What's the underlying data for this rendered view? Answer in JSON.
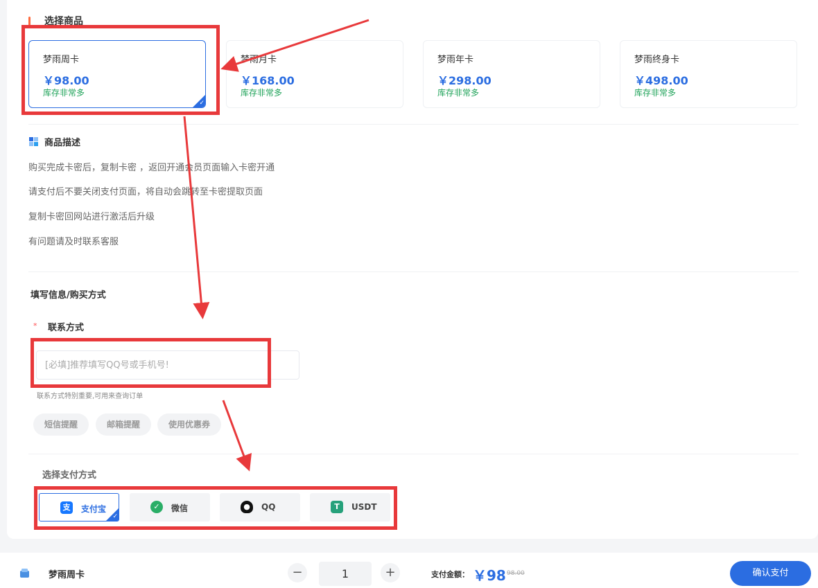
{
  "select_section": {
    "title": "选择商品"
  },
  "products": [
    {
      "name": "梦雨周卡",
      "price": "￥98.00",
      "stock": "库存非常多",
      "selected": true
    },
    {
      "name": "梦雨月卡",
      "price": "￥168.00",
      "stock": "库存非常多",
      "selected": false
    },
    {
      "name": "梦雨年卡",
      "price": "￥298.00",
      "stock": "库存非常多",
      "selected": false
    },
    {
      "name": "梦雨终身卡",
      "price": "￥498.00",
      "stock": "库存非常多",
      "selected": false
    }
  ],
  "description": {
    "title": "商品描述",
    "lines": [
      "购买完成卡密后，复制卡密 ，返回开通会员页面输入卡密开通",
      "请支付后不要关闭支付页面，将自动会跳转至卡密提取页面",
      "复制卡密回网站进行激活后升级",
      "有问题请及时联系客服"
    ]
  },
  "form": {
    "title": "填写信息/购买方式",
    "required_mark": "*",
    "contact_label": "联系方式",
    "contact_placeholder": "[必填]推荐填写QQ号或手机号!",
    "contact_value": "",
    "contact_hint": "联系方式特别重要,可用来查询订单",
    "options": [
      "短信提醒",
      "邮箱提醒",
      "使用优惠券"
    ]
  },
  "payment": {
    "title": "选择支付方式",
    "methods": [
      {
        "label": "支付宝",
        "icon": "alipay-icon",
        "color": "#1677ff",
        "selected": true
      },
      {
        "label": "微信",
        "icon": "wechat-icon",
        "color": "#2aae67",
        "selected": false
      },
      {
        "label": "QQ",
        "icon": "qq-icon",
        "color": "#111111",
        "selected": false
      },
      {
        "label": "USDT",
        "icon": "usdt-icon",
        "color": "#26a17b",
        "selected": false
      }
    ]
  },
  "bottom_bar": {
    "product_name": "梦雨周卡",
    "quantity": "1",
    "minus": "−",
    "plus": "+",
    "amount_label": "支付金额：",
    "amount": "￥98",
    "original_amount": "98.00",
    "confirm_label": "确认支付"
  },
  "colors": {
    "accent": "#2b6de1",
    "stock_green": "#20a35a",
    "annotation_red": "#e8393b"
  }
}
